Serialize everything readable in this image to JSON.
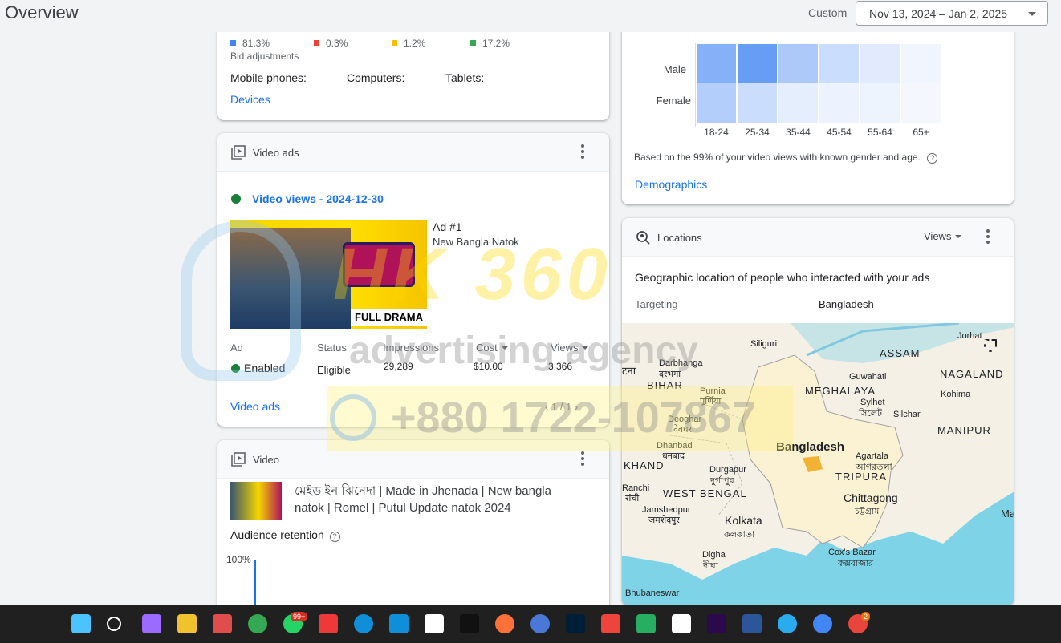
{
  "header": {
    "title": "Overview",
    "custom_label": "Custom",
    "date_range": "Nov 13, 2024 – Jan 2, 2025"
  },
  "devices": {
    "legend": [
      {
        "value": "81.3%",
        "color": "#4285f4"
      },
      {
        "value": "0.3%",
        "color": "#ea4335"
      },
      {
        "value": "1.2%",
        "color": "#fbbc04"
      },
      {
        "value": "17.2%",
        "color": "#34a853"
      }
    ],
    "bid_label": "Bid adjustments",
    "mobile": "Mobile phones: —",
    "computers": "Computers: —",
    "tablets": "Tablets: —",
    "link": "Devices"
  },
  "video_ads": {
    "title": "Video ads",
    "status_title": "Video views - 2024-12-30",
    "ad_name": "Ad #1",
    "ad_sub": "New Bangla Natok",
    "thumb_text": "FULL DRAMA",
    "columns": {
      "ad": "Ad",
      "status": "Status",
      "impressions": "Impressions",
      "cost": "Cost",
      "views": "Views"
    },
    "row": {
      "ad": "Enabled",
      "status": "Eligible",
      "impressions": "29,289",
      "cost": "$10.00",
      "views": "3,366"
    },
    "link": "Video ads",
    "pager": "1 / 1"
  },
  "video": {
    "title": "Video",
    "name_line1": "মেইড ইন ঝিনেদা | Made in Jhenada | New bangla",
    "name_line2": "natok | Romel | Putul Update natok 2024",
    "retention_label": "Audience retention",
    "y_tick": "100%"
  },
  "demographics": {
    "rows": [
      "Male",
      "Female"
    ],
    "cols": [
      "18-24",
      "25-34",
      "35-44",
      "45-54",
      "55-64",
      "65+"
    ],
    "male_intensity": [
      0.75,
      0.95,
      0.5,
      0.3,
      0.15,
      0.05
    ],
    "female_intensity": [
      0.45,
      0.3,
      0.12,
      0.08,
      0.06,
      0.03
    ],
    "note": "Based on the 99% of your video views with known gender and age.",
    "link": "Demographics"
  },
  "locations": {
    "title": "Locations",
    "metric": "Views",
    "subtitle": "Geographic location of people who interacted with your ads",
    "targeting_label": "Targeting",
    "targeting_value": "Bangladesh",
    "map_labels": {
      "assam": "ASSAM",
      "nagaland": "NAGALAND",
      "meghalaya": "MEGHALAYA",
      "manipur": "MANIPUR",
      "tripura": "TRIPURA",
      "bihar": "BIHAR",
      "west_bengal": "WEST BENGAL",
      "khand": "KHAND",
      "bangladesh": "Bangladesh",
      "kolkata": "Kolkata",
      "kolkata_bn": "কলকাতা",
      "chittagong": "Chittagong",
      "chittagong_bn": "চট্টগ্রাম",
      "siliguri": "Siliguri",
      "darbhanga": "Darbhanga",
      "darbhanga_bn": "दरभंगा",
      "purnia": "Purnia",
      "purnia_bn": "पूर्णिया",
      "guwahati": "Guwahati",
      "sylhet": "Sylhet",
      "sylhet_bn": "সিলেট",
      "silchar": "Silchar",
      "kohima": "Kohima",
      "jorhat": "Jorhat",
      "deoghar": "Deoghar",
      "deoghar_bn": "देवघर",
      "dhanbad": "Dhanbad",
      "dhanbad_bn": "धनबाद",
      "durgapur": "Durgapur",
      "durgapur_bn": "দুর্গাপুর",
      "ranchi": "Ranchi",
      "ranchi_bn": "रांची",
      "jamshedpur": "Jamshedpur",
      "jamshedpur_bn": "जमशेदपुर",
      "digha": "Digha",
      "digha_bn": "দীঘা",
      "coxs": "Cox's Bazar",
      "coxs_bn": "কক্সবাজার",
      "agartala": "Agartala",
      "agartala_bn": "আগরতলা",
      "bhubaneswar": "Bhubaneswar",
      "patna": "टना",
      "ma": "Ma"
    }
  },
  "watermark": {
    "brand": "HK 360",
    "tagline": "advertising agency",
    "phone": "+880 1722-107867"
  },
  "taskbar": {
    "icons": [
      "windows-start-icon",
      "search-icon",
      "copilot-icon",
      "file-explorer-icon",
      "snipping-tool-icon",
      "chrome-icon",
      "whatsapp-icon",
      "vivaldi-icon",
      "edge-icon",
      "microsoft-store-icon",
      "capcut-icon",
      "capcut-desktop-icon",
      "firefox-icon",
      "sync-icon",
      "photoshop-icon",
      "anydesk-icon",
      "app-installer-icon",
      "capcut-alt-icon",
      "premiere-pro-icon",
      "word-icon",
      "telegram-icon",
      "google-ads-icon",
      "chrome-profile-icon"
    ],
    "whatsapp_badge": "99+",
    "chrome_badge": "2"
  }
}
